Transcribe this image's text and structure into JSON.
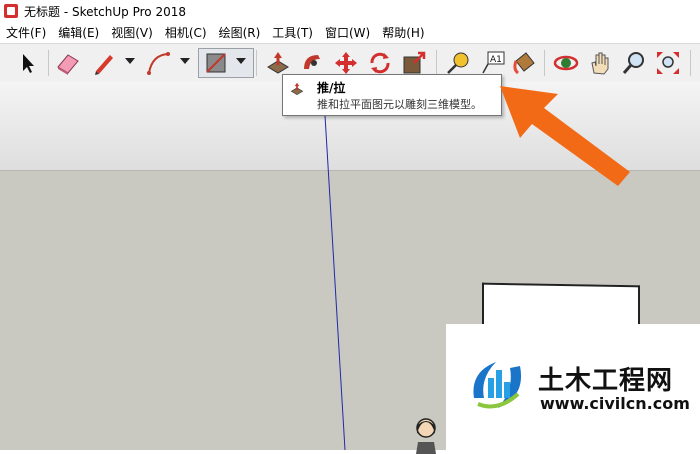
{
  "window": {
    "title": "无标题 - SketchUp Pro 2018"
  },
  "menu": [
    {
      "label": "文件(F)"
    },
    {
      "label": "编辑(E)"
    },
    {
      "label": "视图(V)"
    },
    {
      "label": "相机(C)"
    },
    {
      "label": "绘图(R)"
    },
    {
      "label": "工具(T)"
    },
    {
      "label": "窗口(W)"
    },
    {
      "label": "帮助(H)"
    }
  ],
  "toolbar": {
    "tools": [
      "select-icon",
      "eraser-icon",
      "pencil-icon",
      "arc-icon",
      "rectangle-icon",
      "push-pull-icon",
      "follow-me-icon",
      "move-icon",
      "rotate-icon",
      "scale-icon",
      "tape-measure-icon",
      "text-icon",
      "paint-bucket-icon",
      "orbit-icon",
      "pan-icon",
      "zoom-icon",
      "zoom-extents-icon"
    ],
    "active_tool": "push-pull"
  },
  "tooltip": {
    "title": "推/拉",
    "description": "推和拉平面图元以雕刻三维模型。"
  },
  "watermark": {
    "brand": "土木工程网",
    "url": "www.civilcn.com"
  },
  "colors": {
    "arrow": "#f26a16",
    "sky": "#f0f0f0",
    "ground": "#c9c9c2",
    "axis": "#1f2aa8"
  }
}
